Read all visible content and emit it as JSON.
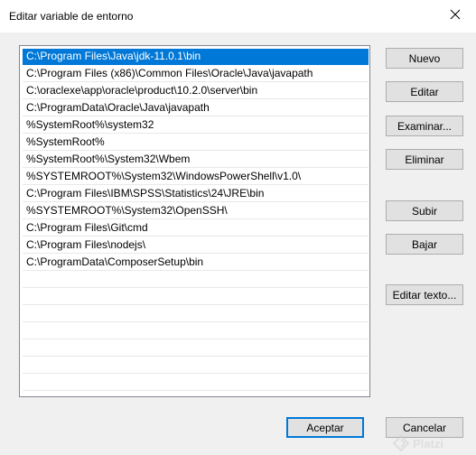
{
  "window": {
    "title": "Editar variable de entorno",
    "close_icon": "close-icon"
  },
  "list": {
    "selected_index": 0,
    "items": [
      "C:\\Program Files\\Java\\jdk-11.0.1\\bin",
      "C:\\Program Files (x86)\\Common Files\\Oracle\\Java\\javapath",
      "C:\\oraclexe\\app\\oracle\\product\\10.2.0\\server\\bin",
      "C:\\ProgramData\\Oracle\\Java\\javapath",
      "%SystemRoot%\\system32",
      "%SystemRoot%",
      "%SystemRoot%\\System32\\Wbem",
      "%SYSTEMROOT%\\System32\\WindowsPowerShell\\v1.0\\",
      "C:\\Program Files\\IBM\\SPSS\\Statistics\\24\\JRE\\bin",
      "%SYSTEMROOT%\\System32\\OpenSSH\\",
      "C:\\Program Files\\Git\\cmd",
      "C:\\Program Files\\nodejs\\",
      "C:\\ProgramData\\ComposerSetup\\bin",
      "",
      "",
      "",
      "",
      "",
      "",
      "",
      ""
    ]
  },
  "buttons": {
    "new": "Nuevo",
    "edit": "Editar",
    "browse": "Examinar...",
    "delete": "Eliminar",
    "up": "Subir",
    "down": "Bajar",
    "edit_text": "Editar texto...",
    "accept": "Aceptar",
    "cancel": "Cancelar"
  },
  "watermark": {
    "text": "Platzi",
    "icon": "platzi-logo-icon"
  }
}
